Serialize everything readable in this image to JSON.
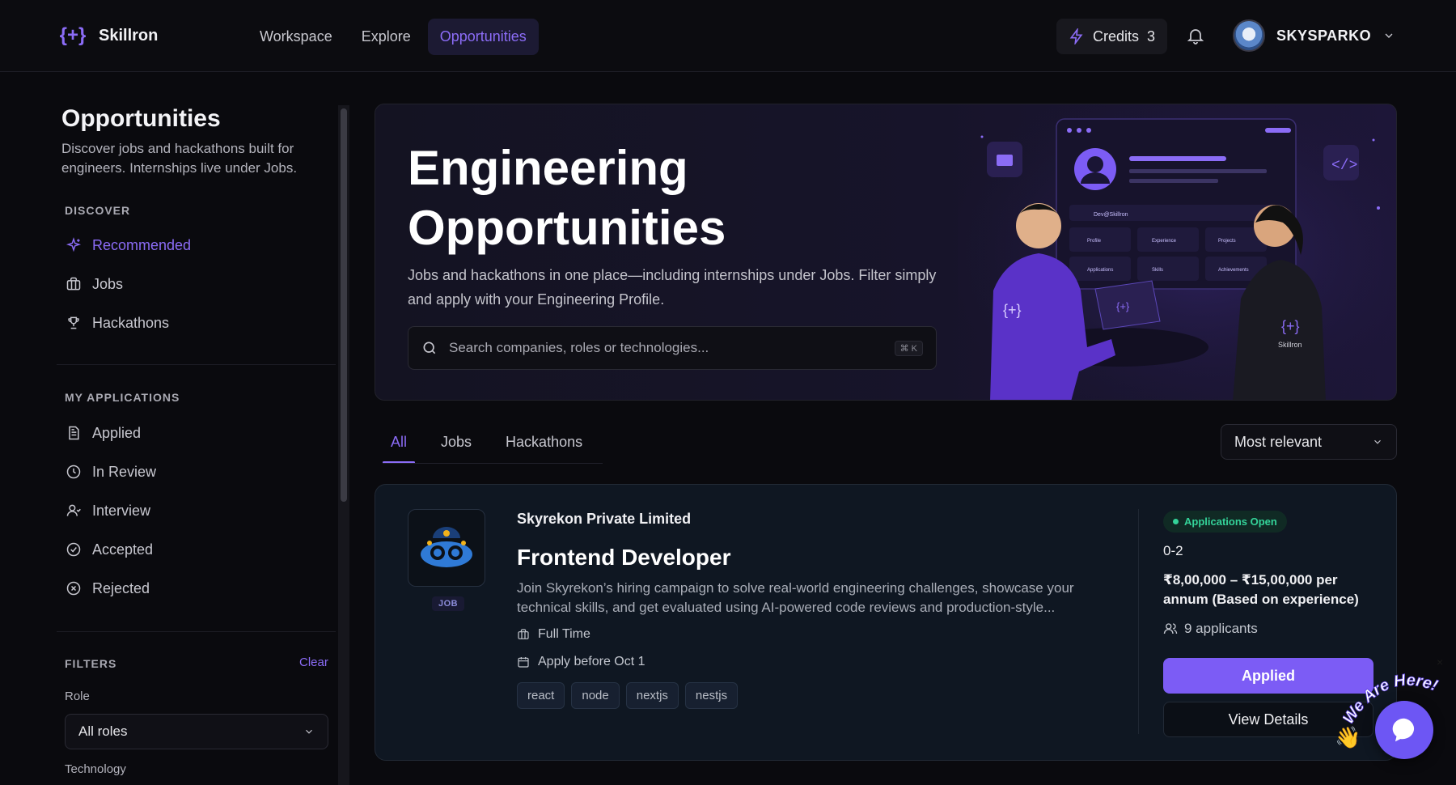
{
  "brand": {
    "name": "Skillron",
    "logo_glyph": "{+}"
  },
  "nav": {
    "links": [
      "Workspace",
      "Explore",
      "Opportunities"
    ],
    "active": "Opportunities"
  },
  "credits": {
    "label": "Credits",
    "value": "3"
  },
  "user": {
    "name": "SKYSPARKO"
  },
  "sidebar": {
    "title": "Opportunities",
    "description": "Discover jobs and hackathons built for engineers. Internships live under Jobs.",
    "discover_label": "DISCOVER",
    "discover_items": [
      {
        "label": "Recommended",
        "icon": "sparkle-icon"
      },
      {
        "label": "Jobs",
        "icon": "briefcase-icon"
      },
      {
        "label": "Hackathons",
        "icon": "trophy-icon"
      }
    ],
    "applications_label": "MY APPLICATIONS",
    "application_items": [
      {
        "label": "Applied",
        "icon": "document-icon"
      },
      {
        "label": "In Review",
        "icon": "clock-icon"
      },
      {
        "label": "Interview",
        "icon": "user-icon"
      },
      {
        "label": "Accepted",
        "icon": "check-circle-icon"
      },
      {
        "label": "Rejected",
        "icon": "x-circle-icon"
      }
    ],
    "filters_label": "FILTERS",
    "clear_label": "Clear",
    "role_label": "Role",
    "role_value": "All roles",
    "technology_label": "Technology"
  },
  "hero": {
    "title": "Engineering Opportunities",
    "description": "Jobs and hackathons in one place—including internships under Jobs. Filter simply and apply with your Engineering Profile.",
    "search_placeholder": "Search companies, roles or technologies...",
    "shortcut": "⌘ K",
    "illustration": {
      "card_name": "Dev@Skillron",
      "tiles": [
        "Profile",
        "Experience",
        "Projects",
        "Applications",
        "Skills",
        "Achievements"
      ],
      "hoodie_text": "Skillron"
    }
  },
  "tabs": {
    "items": [
      "All",
      "Jobs",
      "Hackathons"
    ],
    "active": "All"
  },
  "sort": {
    "value": "Most relevant"
  },
  "job": {
    "badge": "JOB",
    "company": "Skyrekon Private Limited",
    "title": "Frontend Developer",
    "description": "Join Skyrekon’s hiring campaign to solve real-world engineering challenges, showcase your technical skills, and get evaluated using AI-powered code reviews and production-style...",
    "type": "Full Time",
    "deadline": "Apply before Oct 1",
    "tags": [
      "react",
      "node",
      "nextjs",
      "nestjs"
    ],
    "status": "Applications Open",
    "experience": "0-2",
    "salary": "₹8,00,000 – ₹15,00,000 per annum (Based on experience)",
    "applicants": "9 applicants",
    "applied_label": "Applied",
    "details_label": "View Details"
  },
  "chat": {
    "badge_text": "We Are Here!",
    "close": "×"
  },
  "colors": {
    "accent": "#8b6cf6",
    "status_green": "#34d399",
    "background": "#0a0a0e"
  }
}
